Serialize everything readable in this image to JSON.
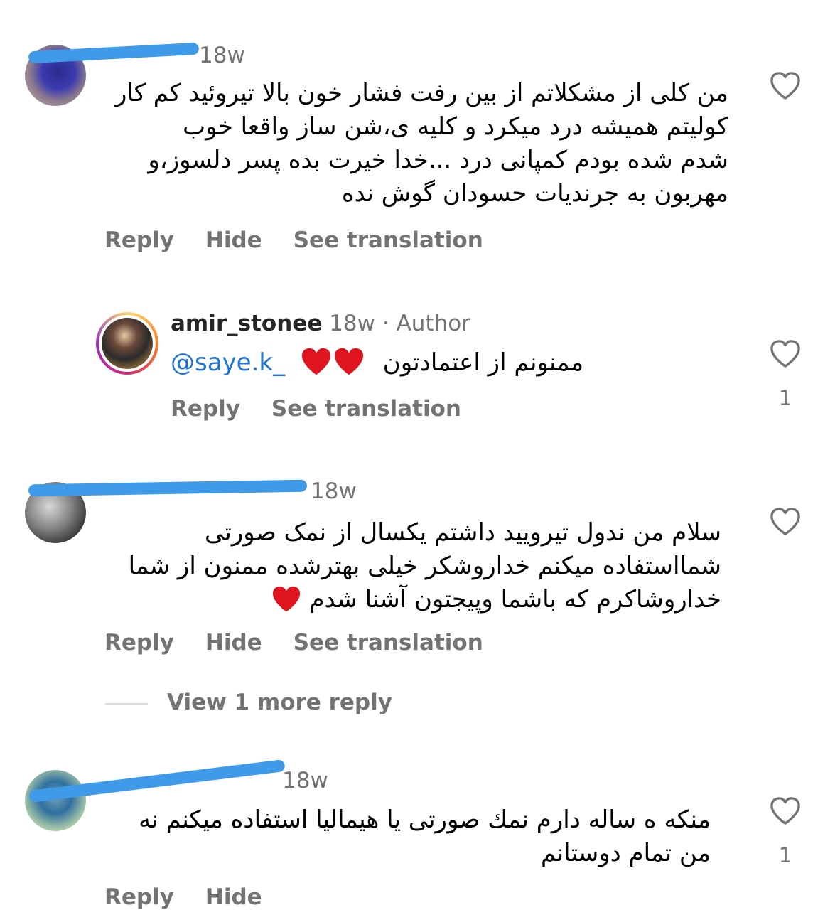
{
  "comments": [
    {
      "time": "18w",
      "text_lines": [
        "من کلی از مشکلاتم از بین رفت فشار خون بالا تیروئید کم کار",
        "کولیتم همیشه درد میکرد و کلیه ی،شن ساز واقعا خوب",
        "شدم شده بودم کمپانی درد ...خدا خیرت بده پسر دلسوز،و",
        "مهربون به جرندیات حسودان گوش نده"
      ],
      "actions": [
        "Reply",
        "Hide",
        "See translation"
      ]
    },
    {
      "username": "amir_stonee",
      "time": "18w",
      "author_badge": "· Author",
      "mention": "@saye.k_",
      "text": "ممنونم از اعتمادتون",
      "actions": [
        "Reply",
        "See translation"
      ],
      "like_count": "1"
    },
    {
      "time": "18w",
      "text_lines": [
        "سلام من ندول تیرویید داشتم یکسال از نمک صورتی",
        "شمااستفاده میکنم خداروشکر خیلی بهترشده ممنون از شما",
        "خداروشاکرم که باشما وپیجتون آشنا شدم"
      ],
      "actions": [
        "Reply",
        "Hide",
        "See translation"
      ],
      "view_more": "View 1 more reply"
    },
    {
      "time": "18w",
      "text_lines": [
        "منکه ه ساله دارم نمك صورتى يا هيماليا استفاده ميكنم نه",
        "من تمام دوستانم"
      ],
      "actions": [
        "Reply",
        "Hide"
      ],
      "like_count": "1"
    }
  ],
  "colors": {
    "text": "#000000",
    "secondary": "#737373",
    "mention": "#1d74d6",
    "heart_red": "#e0141e",
    "redaction": "#3f9be9"
  },
  "icons": [
    "like-heart-icon",
    "red-heart-emoji"
  ]
}
